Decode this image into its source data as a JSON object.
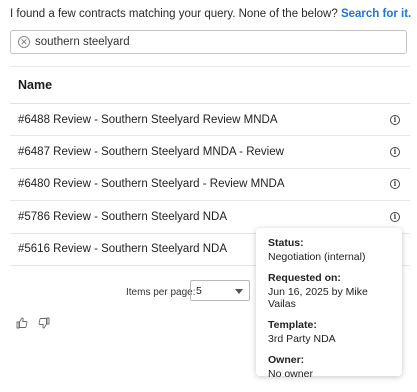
{
  "intro": {
    "text": "I found a few contracts matching your query. None of the below?",
    "link": "Search for it."
  },
  "search": {
    "value": "southern steelyard"
  },
  "table": {
    "header": "Name",
    "rows": [
      "#6488 Review - Southern Steelyard Review MNDA",
      "#6487 Review - Southern Steelyard MNDA - Review",
      "#6480 Review - Southern Steelyard - Review MNDA",
      "#5786 Review - Southern Steelyard NDA",
      "#5616 Review - Southern Steelyard NDA"
    ]
  },
  "pagination": {
    "label": "Items per page:",
    "value": "5"
  },
  "tooltip": {
    "status_label": "Status:",
    "status": "Negotiation (internal)",
    "requested_label": "Requested on:",
    "requested": "Jun 16, 2025 by Mike Vailas",
    "template_label": "Template:",
    "template": "3rd Party NDA",
    "owner_label": "Owner:",
    "owner": "No owner"
  },
  "icons": {
    "clear": "close-circle-icon",
    "info": "info-icon",
    "like": "thumbs-up-icon",
    "dislike": "thumbs-down-icon"
  },
  "colors": {
    "link": "#1f74d4"
  }
}
